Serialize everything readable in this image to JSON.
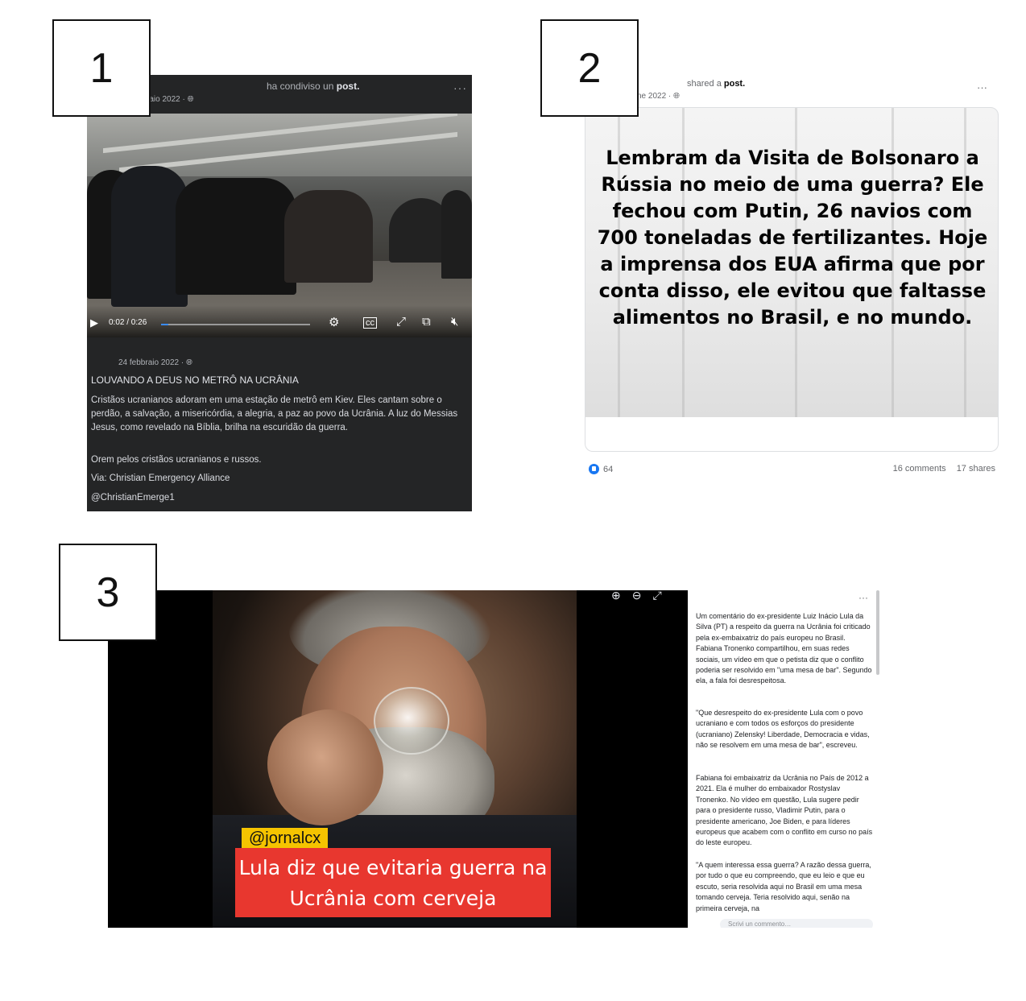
{
  "labels": {
    "one": "1",
    "two": "2",
    "three": "3"
  },
  "panel1": {
    "header_shared": "ha condiviso un",
    "header_post": "post.",
    "header_date": "raio 2022 · ",
    "video_time": "0:02 / 0:26",
    "post_date": "24 febbraio 2022 · ",
    "title": "LOUVANDO A DEUS NO METRÔ NA UCRÂNIA",
    "desc": "Cristãos ucranianos adoram em uma estação de metrô em Kiev. Eles cantam sobre o perdão, a salvação, a misericórdia, a alegria, a paz ao povo da Ucrânia. A luz do Messias Jesus, como revelado na Bíblia, brilha na escuridão da guerra.",
    "pray": "Orem pelos cristãos ucranianos e russos.",
    "via": "Via: Christian Emergency Alliance",
    "handle": "@ChristianEmerge1",
    "more": "···"
  },
  "panel2": {
    "header_shared": "shared a",
    "header_post": "post.",
    "header_date": "ne 2022 · ",
    "more": "···",
    "message": "Lembram da Visita de Bolsonaro a Rússia  no meio de uma guerra? Ele fechou com Putin, 26 navios com 700 toneladas de fertilizantes. Hoje a imprensa dos EUA afirma que por conta disso, ele evitou que  faltasse alimentos no Brasil, e no mundo.",
    "reactions": "64",
    "comments": "16 comments",
    "shares": "17 shares"
  },
  "panel3": {
    "tag": "@jornalcx",
    "caption": "Lula diz que evitaria guerra na Ucrânia com cerveja",
    "zoom_icons": "⊕⊖⤢",
    "more": "···",
    "para1": "Um comentário do ex-presidente Luiz Inácio Lula da Silva (PT) a respeito da guerra na Ucrânia foi criticado pela ex-embaixatriz do país europeu no Brasil. Fabiana Tronenko compartilhou, em suas redes sociais, um vídeo em que o petista diz que o conflito poderia ser resolvido em \"uma mesa de bar\". Segundo ela, a fala foi desrespeitosa.",
    "para2": "\"Que desrespeito do ex-presidente Lula com o povo ucraniano e com todos os esforços do presidente (ucraniano) Zelensky! Liberdade, Democracia e vidas, não se resolvem em uma mesa de bar\", escreveu.",
    "para3": "Fabiana foi embaixatriz da Ucrânia no País de 2012 a 2021. Ela é mulher do embaixador Rostyslav Tronenko. No vídeo em questão, Lula sugere pedir para o presidente russo, Vladimir Putin, para o presidente americano, Joe Biden, e para líderes europeus que acabem com o conflito em curso no país do leste europeu.",
    "para4": "\"A quem interessa essa guerra? A razão dessa guerra, por tudo o que eu compreendo, que eu leio e que eu escuto, seria resolvida aqui no Brasil em uma mesa tomando cerveja. Teria resolvido aqui, senão na primeira cerveja, na",
    "comment_placeholder": "Scrivi un commento…"
  }
}
